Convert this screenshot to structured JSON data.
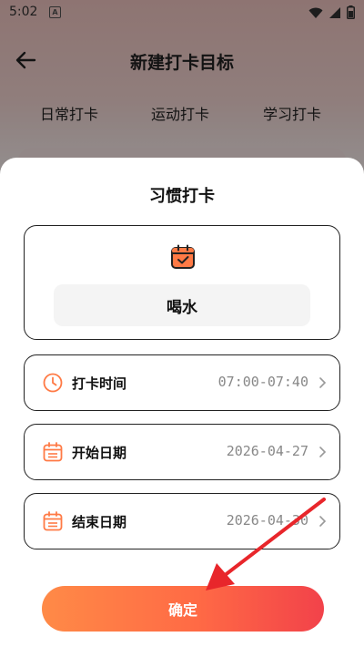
{
  "status": {
    "time": "5:02",
    "notif_letter": "A"
  },
  "nav": {
    "title": "新建打卡目标"
  },
  "tabs": [
    "日常打卡",
    "运动打卡",
    "学习打卡"
  ],
  "sheet": {
    "title": "习惯打卡",
    "habit_name": "喝水",
    "rows": [
      {
        "label": "打卡时间",
        "value": "07:00-07:40",
        "icon": "clock-icon"
      },
      {
        "label": "开始日期",
        "value": "2026-04-27",
        "icon": "calendar-icon"
      },
      {
        "label": "结束日期",
        "value": "2026-04-30",
        "icon": "calendar-icon"
      }
    ],
    "confirm_label": "确定"
  },
  "colors": {
    "accent": "#ff6a45",
    "accent_start": "#ff8a47",
    "accent_end": "#f2424a",
    "annotation_arrow": "#e8262b"
  }
}
